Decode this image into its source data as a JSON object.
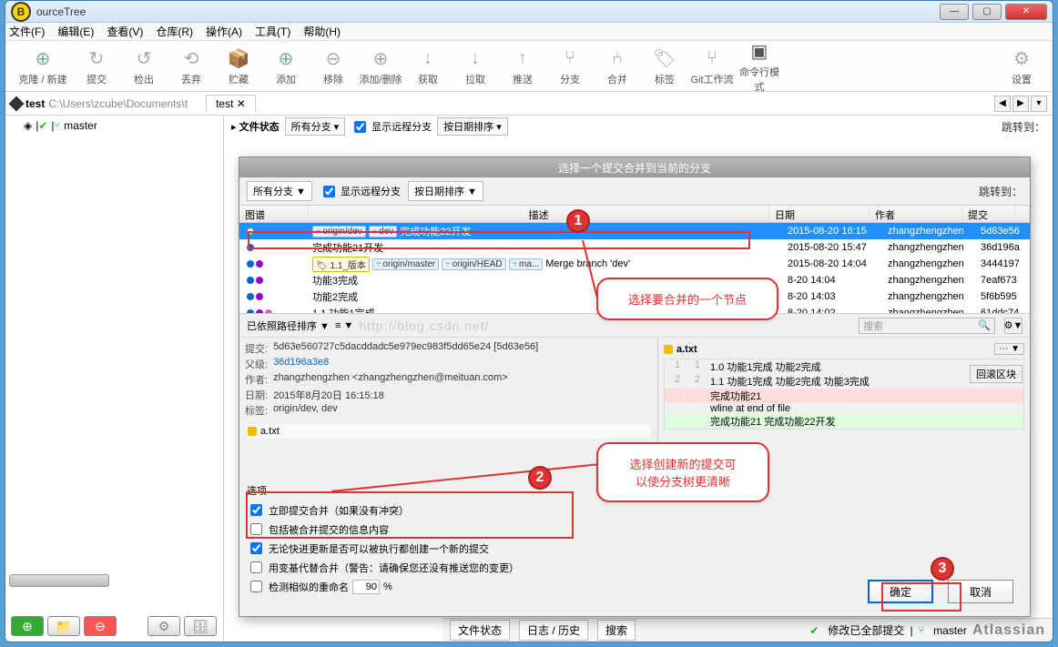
{
  "window": {
    "title": "ourceTree",
    "badge": "B"
  },
  "winbtns": {
    "min": "—",
    "max": "▢",
    "close": "✕"
  },
  "menu": [
    "文件(F)",
    "编辑(E)",
    "查看(V)",
    "仓库(R)",
    "操作(A)",
    "工具(T)",
    "帮助(H)"
  ],
  "toolbar": [
    {
      "label": "克隆 / 新建",
      "glyph": "⊕",
      "cls": "",
      "wide": true
    },
    {
      "label": "提交",
      "glyph": "↻",
      "cls": "gray"
    },
    {
      "label": "检出",
      "glyph": "↺",
      "cls": "gray"
    },
    {
      "label": "丢弃",
      "glyph": "⟲",
      "cls": "gray"
    },
    {
      "label": "贮藏",
      "glyph": "📦",
      "cls": "gray"
    },
    {
      "label": "添加",
      "glyph": "⊕",
      "cls": ""
    },
    {
      "label": "移除",
      "glyph": "⊖",
      "cls": "gray"
    },
    {
      "label": "添加/删除",
      "glyph": "⊕",
      "cls": "gray"
    },
    {
      "label": "获取",
      "glyph": "↓",
      "cls": "gray"
    },
    {
      "label": "拉取",
      "glyph": "↓",
      "cls": "gray"
    },
    {
      "label": "推送",
      "glyph": "↑",
      "cls": "gray"
    },
    {
      "label": "分支",
      "glyph": "⑂",
      "cls": "gray"
    },
    {
      "label": "合并",
      "glyph": "⑃",
      "cls": "gray"
    },
    {
      "label": "标签",
      "glyph": "🏷",
      "cls": "gray"
    },
    {
      "label": "Git工作流",
      "glyph": "⑂",
      "cls": "gray"
    },
    {
      "label": "命令行模式",
      "glyph": "▣",
      "cls": "dark"
    }
  ],
  "toolbar_right": {
    "label": "设置",
    "glyph": "⚙"
  },
  "header": {
    "repo": "test",
    "path": "C:\\Users\\zcube\\Documents\\t",
    "tab": "test",
    "tab_close": "✕"
  },
  "sidebar": {
    "branch": "master",
    "tick": "✔"
  },
  "upper": {
    "filestate": "文件状态",
    "all": "所有分支",
    "showremote": "显示远程分支",
    "sort": "按日期排序",
    "jump": "跳转到："
  },
  "dialog": {
    "title": "选择一个提交合并到当前的分支",
    "all": "所有分支",
    "show_remote": "显示远程分支",
    "sort": "按日期排序",
    "jump": "跳转到：",
    "cols": {
      "graph": "图谱",
      "desc": "描述",
      "date": "日期",
      "author": "作者",
      "sha": "提交"
    },
    "rows": [
      {
        "sel": true,
        "tags": [
          "origin/dev",
          "dev"
        ],
        "desc": "完成功能22开发",
        "date": "2015-08-20 16:15",
        "author": "zhangzhengzhen",
        "sha": "5d63e56"
      },
      {
        "desc": "完成功能21开发",
        "date": "2015-08-20 15:47",
        "author": "zhangzhengzhen",
        "sha": "36d196a"
      },
      {
        "ver": "1.1_版本",
        "tags": [
          "origin/master",
          "origin/HEAD"
        ],
        "partial": "ma",
        "desc": "Merge branch 'dev'",
        "date": "2015-08-20 14:04",
        "author": "zhangzhengzhen",
        "sha": "3444197"
      },
      {
        "desc": "功能3完成",
        "date": "8-20 14:04",
        "author": "zhangzhengzhen",
        "sha": "7eaf673"
      },
      {
        "desc": "功能2完成",
        "date": "8-20 14:03",
        "author": "zhangzhengzhen",
        "sha": "5f6b595"
      },
      {
        "desc": "1.1 功能1完成",
        "date": "8-20 14:02",
        "author": "zhangzhengzhen",
        "sha": "61ddc74"
      }
    ],
    "sort2": "已依照路径排序",
    "view": "≡",
    "search": "搜索",
    "gear": "⚙",
    "meta": {
      "k_commit": "提交:",
      "commit": "5d63e560727c5dacddadc5e979ec983f5dd65e24 [5d63e56]",
      "k_parent": "父级:",
      "parent": "36d196a3e8",
      "k_author": "作者:",
      "author": "zhangzhengzhen <zhangzhengzhen@meituan.com>",
      "k_date": "日期:",
      "date": "2015年8月20日 16:15:18",
      "k_ref": "标签:",
      "ref": "origin/dev, dev"
    },
    "file": "a.txt",
    "opts": {
      "title": "选项",
      "o1": "立即提交合并（如果没有冲突）",
      "o2": "包括被合并提交的信息内容",
      "o3": "无论快进更新是否可以被执行都创建一个新的提交",
      "o4": "用变基代替合并（警告：请确保您还没有推送您的变更）",
      "o5": "检测相似的重命名",
      "pct": "90",
      "pct_suffix": "%"
    },
    "ok": "确定",
    "cancel": "取消",
    "diff_file": "a.txt",
    "rollback": "回滚区块",
    "diff": [
      {
        "ln1": "1",
        "ln2": "1",
        "txt": "1.0 功能1完成 功能2完成"
      },
      {
        "ln1": "2",
        "ln2": "2",
        "txt": "1.1 功能1完成 功能2完成 功能3完成"
      },
      {
        "ln1": "",
        "ln2": "",
        "txt": "完成功能21",
        "cls": "diff-del"
      },
      {
        "ln1": "",
        "ln2": "",
        "txt": "wline at end of file",
        "cls": ""
      },
      {
        "ln1": "",
        "ln2": "",
        "txt": "完成功能21 完成功能22开发",
        "cls": "diff-add"
      }
    ]
  },
  "anno": {
    "n1": "1",
    "n2": "2",
    "n3": "3",
    "bubble1": "选择要合并的一个节点",
    "bubble2a": "选择创建新的提交可",
    "bubble2b": "以使分支树更清晰"
  },
  "watermark": "http://blog.csdn.net/",
  "status": {
    "file": "文件状态",
    "history": "日志 / 历史",
    "search": "搜索",
    "pushed": "修改已全部提交",
    "branch": "master",
    "brand": "Atlassian"
  }
}
